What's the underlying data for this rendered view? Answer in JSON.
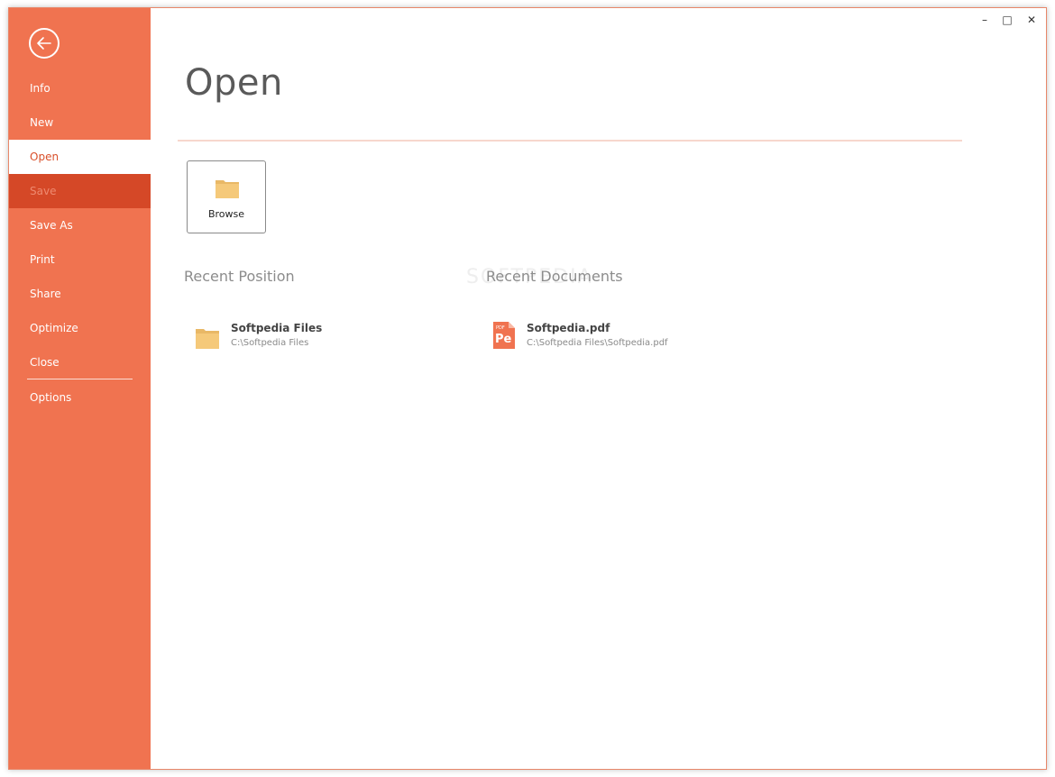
{
  "nav": {
    "items": [
      {
        "label": "Info",
        "state": "normal"
      },
      {
        "label": "New",
        "state": "normal"
      },
      {
        "label": "Open",
        "state": "active"
      },
      {
        "label": "Save",
        "state": "disabled"
      },
      {
        "label": "Save As",
        "state": "normal"
      },
      {
        "label": "Print",
        "state": "normal"
      },
      {
        "label": "Share",
        "state": "normal"
      },
      {
        "label": "Optimize",
        "state": "normal"
      },
      {
        "label": "Close",
        "state": "normal"
      },
      {
        "label": "Options",
        "state": "normal"
      }
    ]
  },
  "main": {
    "title": "Open",
    "browse_label": "Browse",
    "recent_position": {
      "heading": "Recent Position",
      "items": [
        {
          "name": "Softpedia Files",
          "path": "C:\\Softpedia Files"
        }
      ]
    },
    "recent_documents": {
      "heading": "Recent Documents",
      "items": [
        {
          "name": "Softpedia.pdf",
          "path": "C:\\Softpedia Files\\Softpedia.pdf"
        }
      ]
    },
    "watermark": "SOFTPEDIA"
  },
  "window_controls": {
    "minimize": "–",
    "maximize": "□",
    "close": "✕"
  },
  "colors": {
    "accent": "#f07350",
    "accent_dark": "#d54827",
    "folder": "#f5c97a"
  }
}
